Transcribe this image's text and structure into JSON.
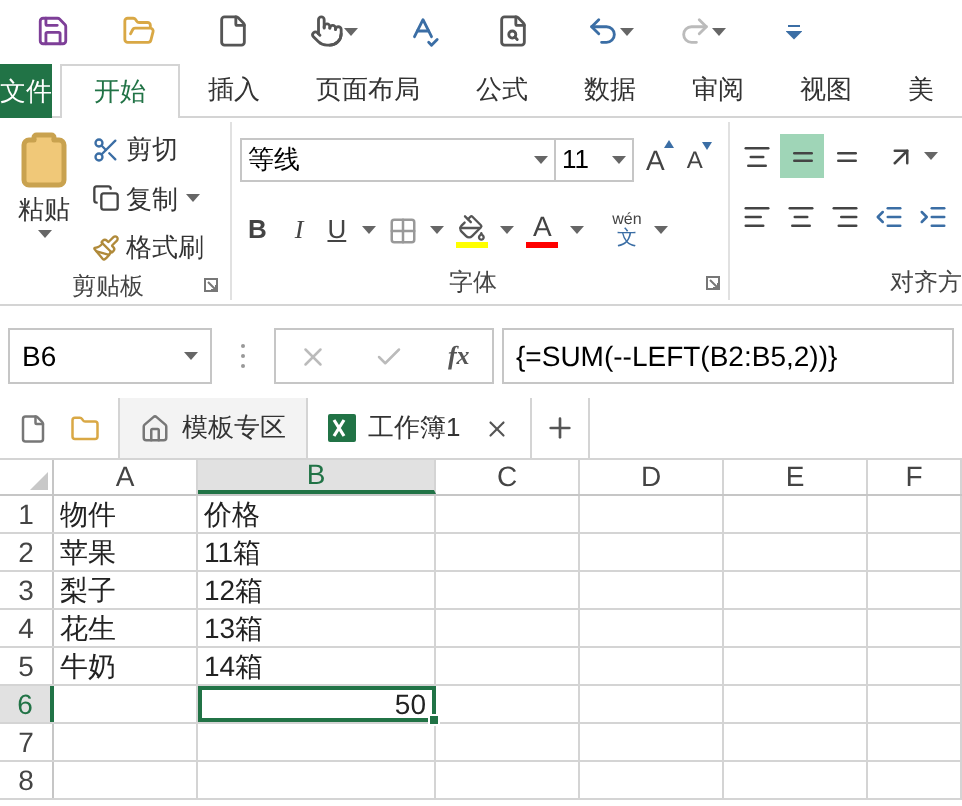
{
  "ribbon_tabs": [
    {
      "label": "文件",
      "kind": "file",
      "selected": false
    },
    {
      "label": "开始",
      "kind": "tab",
      "selected": true
    },
    {
      "label": "插入",
      "kind": "tab",
      "selected": false
    },
    {
      "label": "页面布局",
      "kind": "tab",
      "selected": false
    },
    {
      "label": "公式",
      "kind": "tab",
      "selected": false
    },
    {
      "label": "数据",
      "kind": "tab",
      "selected": false
    },
    {
      "label": "审阅",
      "kind": "tab",
      "selected": false
    },
    {
      "label": "视图",
      "kind": "tab",
      "selected": false
    },
    {
      "label": "美",
      "kind": "tab",
      "selected": false
    }
  ],
  "clipboard": {
    "paste": "粘贴",
    "cut": "剪切",
    "copy": "复制",
    "format_painter": "格式刷",
    "group_label": "剪贴板"
  },
  "font": {
    "name": "等线",
    "size": "11",
    "grow": "A",
    "shrink": "A",
    "bold": "B",
    "italic": "I",
    "underline": "U",
    "font_color": "A",
    "phonetic_top": "wén",
    "phonetic_bottom": "文",
    "group_label": "字体"
  },
  "alignment": {
    "group_label": "对齐方"
  },
  "formula_bar": {
    "name_box": "B6",
    "fx": "fx",
    "formula": "{=SUM(--LEFT(B2:B5,2))}"
  },
  "doc_tabs": [
    {
      "label": "模板专区",
      "kind": "home",
      "selected": false
    },
    {
      "label": "工作簿1",
      "kind": "workbook",
      "selected": true
    }
  ],
  "sheet": {
    "columns": [
      {
        "label": "A",
        "selected": false
      },
      {
        "label": "B",
        "selected": true
      },
      {
        "label": "C",
        "selected": false
      },
      {
        "label": "D",
        "selected": false
      },
      {
        "label": "E",
        "selected": false
      },
      {
        "label": "F",
        "selected": false
      }
    ],
    "rows": [
      {
        "label": "1",
        "selected": false,
        "cells": [
          {
            "text": "物件",
            "kind": "text",
            "selected": false
          },
          {
            "text": "价格",
            "kind": "text",
            "selected": false
          }
        ]
      },
      {
        "label": "2",
        "selected": false,
        "cells": [
          {
            "text": "苹果",
            "kind": "text",
            "selected": false
          },
          {
            "text": "11箱",
            "kind": "text",
            "selected": false
          }
        ]
      },
      {
        "label": "3",
        "selected": false,
        "cells": [
          {
            "text": "梨子",
            "kind": "text",
            "selected": false
          },
          {
            "text": "12箱",
            "kind": "text",
            "selected": false
          }
        ]
      },
      {
        "label": "4",
        "selected": false,
        "cells": [
          {
            "text": "花生",
            "kind": "text",
            "selected": false
          },
          {
            "text": "13箱",
            "kind": "text",
            "selected": false
          }
        ]
      },
      {
        "label": "5",
        "selected": false,
        "cells": [
          {
            "text": "牛奶",
            "kind": "text",
            "selected": false
          },
          {
            "text": "14箱",
            "kind": "text",
            "selected": false
          }
        ]
      },
      {
        "label": "6",
        "selected": true,
        "cells": [
          null,
          {
            "text": "50",
            "kind": "number",
            "selected": true
          }
        ]
      },
      {
        "label": "7",
        "selected": false,
        "cells": []
      },
      {
        "label": "8",
        "selected": false,
        "cells": []
      }
    ]
  }
}
